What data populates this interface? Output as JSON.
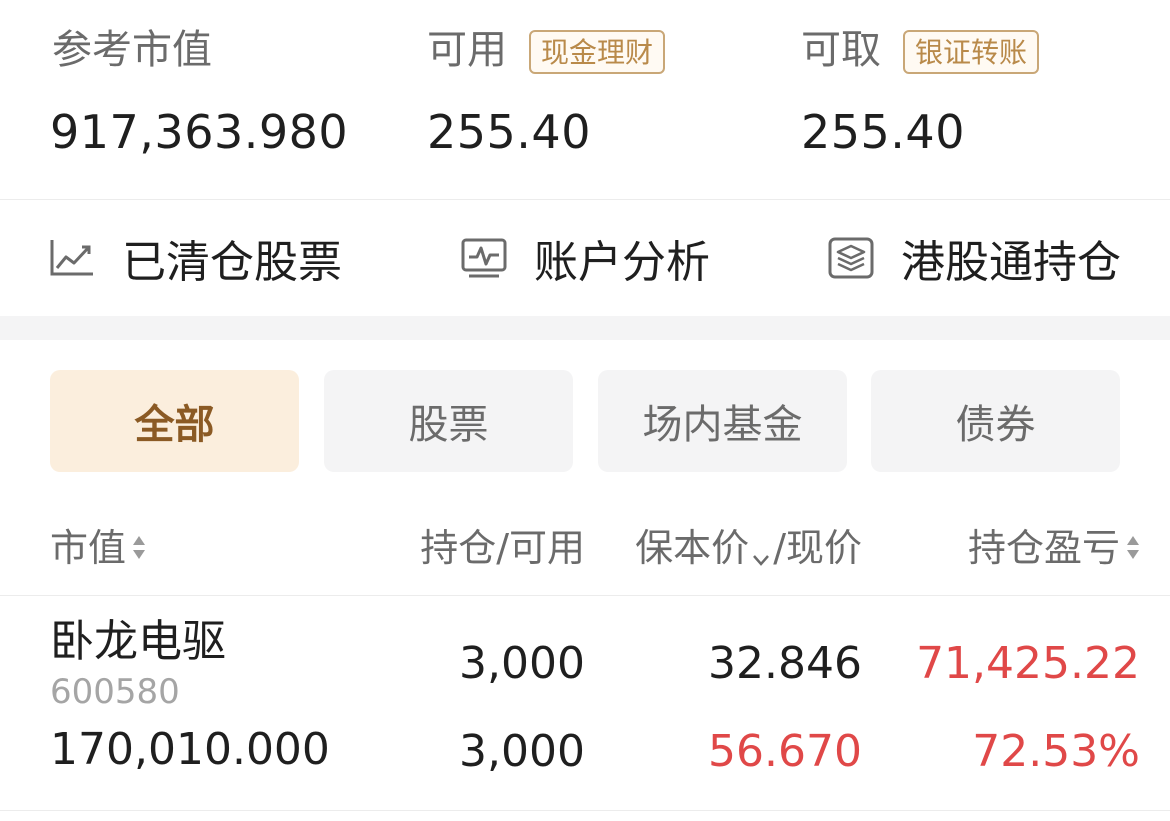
{
  "summary": {
    "market_value_label": "参考市值",
    "market_value": "917,363.980",
    "available_label": "可用",
    "available_tag": "现金理财",
    "available_value": "255.40",
    "withdrawable_label": "可取",
    "withdrawable_tag": "银证转账",
    "withdrawable_value": "255.40"
  },
  "shortcuts": [
    {
      "label": "已清仓股票",
      "icon": "line-chart-icon"
    },
    {
      "label": "账户分析",
      "icon": "pulse-monitor-icon"
    },
    {
      "label": "港股通持仓",
      "icon": "layers-icon"
    }
  ],
  "filter_tabs": [
    {
      "label": "全部",
      "active": true
    },
    {
      "label": "股票",
      "active": false
    },
    {
      "label": "场内基金",
      "active": false
    },
    {
      "label": "债券",
      "active": false
    }
  ],
  "columns": {
    "market_value": "市值",
    "position": "持仓/可用",
    "cost_price": "保本价",
    "price_sep": "/现价",
    "pnl": "持仓盈亏"
  },
  "holdings": [
    {
      "name": "卧龙电驱",
      "code": "600580",
      "market_value": "170,010.000",
      "position": "3,000",
      "available": "3,000",
      "cost_price": "32.846",
      "current_price": "56.670",
      "pnl": "71,425.22",
      "pnl_pct": "72.53%"
    }
  ],
  "colors": {
    "accent_gold": "#b98a4a",
    "gain_red": "#e04848",
    "active_tab_bg": "#fbeedd"
  }
}
